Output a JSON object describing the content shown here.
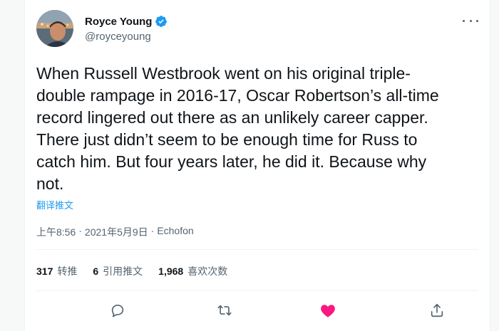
{
  "author": {
    "display_name": "Royce Young",
    "handle": "@royceyoung",
    "verified_icon": "verified-badge-icon"
  },
  "menu": {
    "more_icon": "more-horizontal-icon"
  },
  "tweet": {
    "text_lines": [
      "When Russell Westbrook went on his original triple-",
      "double rampage in 2016-17, Oscar Robertson’s all-time",
      "record lingered out there as an unlikely career capper.",
      "There just didn’t seem to be enough time for Russ to",
      "catch him. But four years later, he did it. Because why",
      "not."
    ],
    "translate_label": "翻译推文"
  },
  "meta": {
    "time": "上午8:56",
    "separator1": "·",
    "date": "2021年5月9日",
    "separator2": "·",
    "source": "Echofon"
  },
  "stats": {
    "retweets_count": "317",
    "retweets_label": "转推",
    "quotes_count": "6",
    "quotes_label": "引用推文",
    "likes_count": "1,968",
    "likes_label": "喜欢次数"
  },
  "actions": {
    "reply_icon": "reply-icon",
    "retweet_icon": "retweet-icon",
    "like_icon": "heart-filled-icon",
    "share_icon": "share-icon"
  },
  "colors": {
    "accent": "#1d9bf0",
    "like": "#f91880",
    "text_secondary": "#536471"
  }
}
